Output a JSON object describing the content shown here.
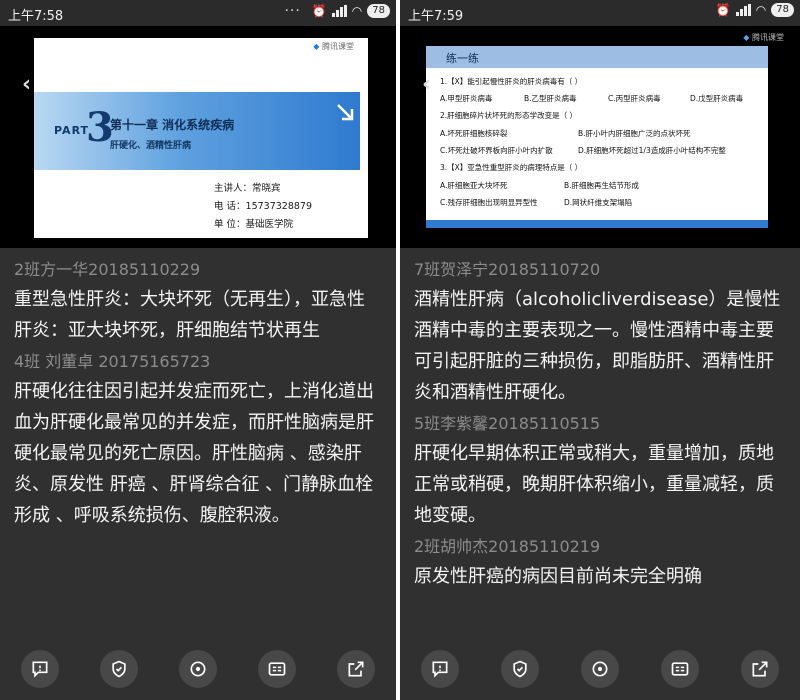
{
  "colors": {
    "background": "#303030",
    "author": "#8c8c8c",
    "text": "#f4f4f4",
    "slide_blue": "#2f7ad0"
  },
  "left": {
    "status": {
      "time": "上午7:58",
      "battery": "78"
    },
    "slide": {
      "brand": "腾讯课堂",
      "part_label": "PART",
      "part_number": "3",
      "chapter_title": "第十一章  消化系统疾病",
      "chapter_subtitle": "肝硬化、酒精性肝病",
      "lecturer": "主讲人：常晓宾",
      "phone": "电    话：15737328879",
      "unit": "单    位：基础医学院"
    },
    "comments": [
      {
        "author": "2班方一华20185110229",
        "text": "重型急性肝炎：大块坏死（无再生），亚急性肝炎：亚大块坏死，肝细胞结节状再生"
      },
      {
        "author": "4班 刘董卓 20175165723",
        "text": " 肝硬化往往因引起并发症而死亡，上消化道出血为肝硬化最常见的并发症，而肝性脑病是肝硬化最常见的死亡原因。肝性脑病 、感染肝炎、原发性 肝癌 、肝肾综合征 、门静脉血栓形成 、呼吸系统损伤、腹腔积液。"
      }
    ]
  },
  "right": {
    "status": {
      "time": "上午7:59",
      "battery": "78"
    },
    "slide": {
      "brand": "腾讯课堂",
      "title": "练一练",
      "q1": "1.【X】能引起慢性肝炎的肝炎病毒有（    ）",
      "q1_a": "A.甲型肝炎病毒",
      "q1_b": "B.乙型肝炎病毒",
      "q1_c": "C.丙型肝炎病毒",
      "q1_d": "D.戊型肝炎病毒",
      "q2": "2.肝细胞碎片状坏死的形态学改变是（    ）",
      "q2_a": "A.坏死肝细胞核碎裂",
      "q2_b": "B.肝小叶内肝细胞广泛的点状坏死",
      "q2_c": "C.坏死灶破坏界板向肝小叶内扩散",
      "q2_d": "D.肝细胞坏死超过1/3造成肝小叶结构不完整",
      "q3": "3.【X】亚急性重型肝炎的病理特点是（    ）",
      "q3_a": "A.肝细胞亚大块坏死",
      "q3_b": "B.肝细胞再生结节形成",
      "q3_c": "C.残存肝细胞出现明显异型性",
      "q3_d": "D.网状纤维支架塌陷"
    },
    "comments": [
      {
        "author": "7班贺泽宁20185110720",
        "text": "酒精性肝病（alcoholicliverdisease）是慢性酒精中毒的主要表现之一。慢性酒精中毒主要可引起肝脏的三种损伤，即脂肪肝、酒精性肝炎和酒精性肝硬化。"
      },
      {
        "author": "5班李紫馨20185110515",
        "text": "肝硬化早期体积正常或稍大，重量增加，质地正常或稍硬，晚期肝体积缩小，重量减轻，质地变硬。"
      },
      {
        "author": "2班胡帅杰20185110219",
        "text": "原发性肝癌的病因目前尚未完全明确"
      }
    ]
  },
  "toolbar_icons": [
    "comment-icon",
    "shield-icon",
    "location-target-icon",
    "id-card-icon",
    "share-icon"
  ]
}
